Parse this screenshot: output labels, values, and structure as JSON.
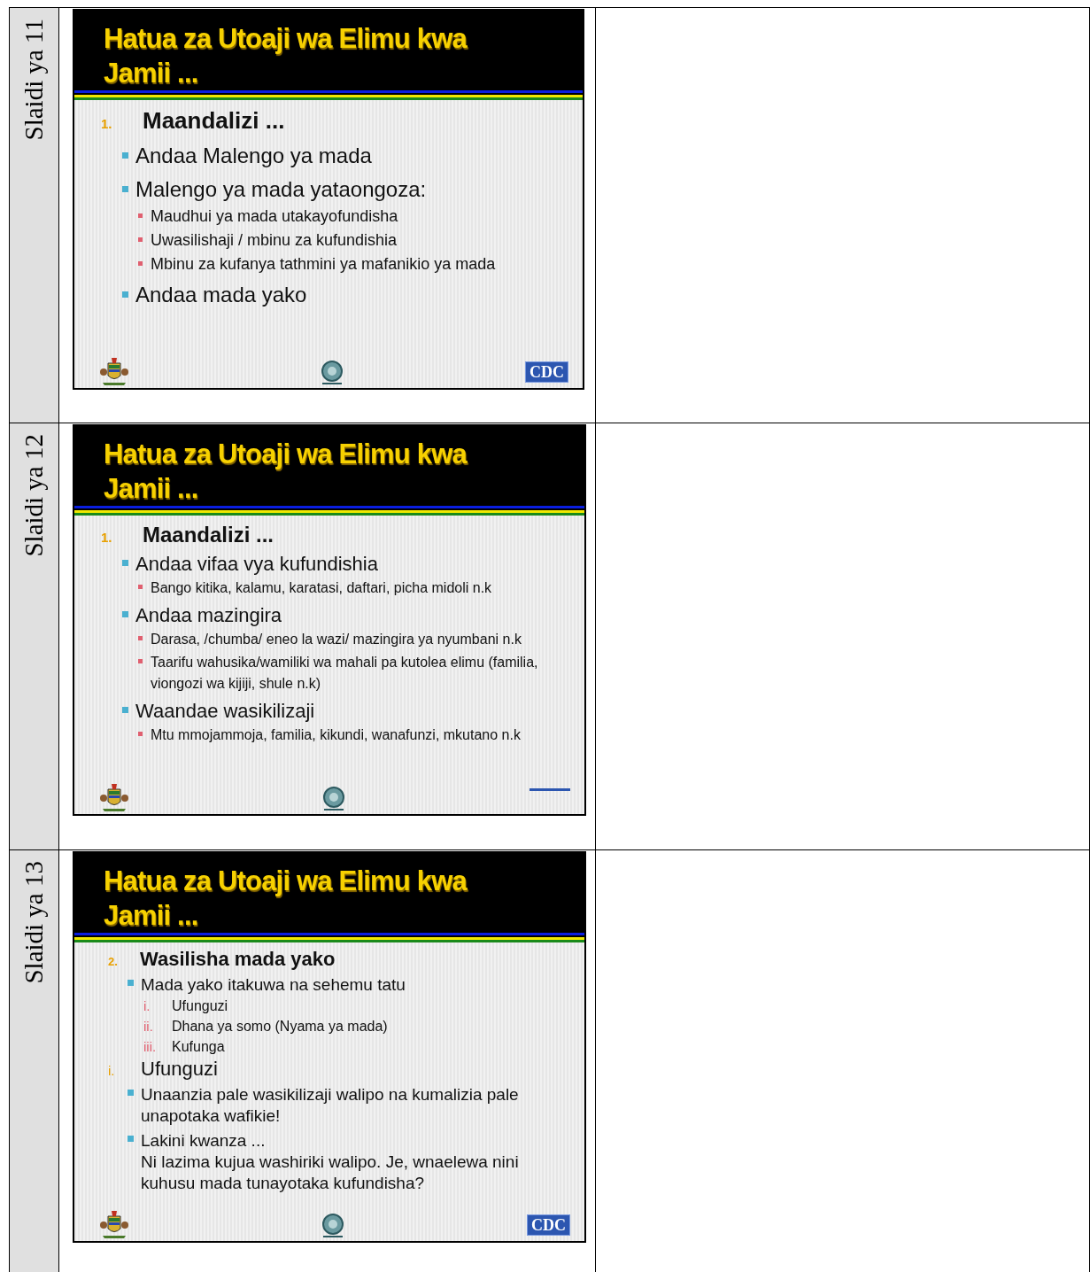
{
  "rows": [
    {
      "label": "Slaidi ya 11",
      "slide": {
        "title": "Hatua za Utoaji wa Elimu kwa Jamii ...",
        "cdc": "CDC",
        "lines": [
          {
            "kind": "heading",
            "marker": "1.",
            "text": "Maandalizi ..."
          },
          {
            "kind": "bullet",
            "text": "Andaa Malengo ya mada"
          },
          {
            "kind": "bullet",
            "text": "Malengo ya mada yataongoza:"
          },
          {
            "kind": "sub",
            "text": "Maudhui ya mada utakayofundisha"
          },
          {
            "kind": "sub",
            "text": "Uwasilishaji / mbinu za kufundishia"
          },
          {
            "kind": "sub",
            "text": "Mbinu za kufanya tathmini  ya mafanikio ya mada"
          },
          {
            "kind": "bullet",
            "text": "Andaa mada yako"
          }
        ]
      }
    },
    {
      "label": "Slaidi ya 12",
      "slide": {
        "title": "Hatua za Utoaji wa Elimu kwa Jamii ...",
        "lines": [
          {
            "kind": "heading",
            "marker": "1.",
            "text": "Maandalizi ..."
          },
          {
            "kind": "bullet",
            "text": "Andaa vifaa vya kufundishia"
          },
          {
            "kind": "sub",
            "text": "Bango kitika, kalamu, karatasi, daftari, picha midoli n.k"
          },
          {
            "kind": "bullet",
            "text": "Andaa mazingira"
          },
          {
            "kind": "sub",
            "text": "Darasa, /chumba/ eneo la wazi/ mazingira ya nyumbani n.k"
          },
          {
            "kind": "sub",
            "text": "Taarifu wahusika/wamiliki wa mahali pa kutolea elimu (familia, viongozi wa kijiji, shule n.k)"
          },
          {
            "kind": "bullet",
            "text": "Waandae wasikilizaji"
          },
          {
            "kind": "sub",
            "text": "Mtu mmojammoja, familia, kikundi, wanafunzi, mkutano n.k"
          }
        ]
      }
    },
    {
      "label": "Slaidi ya 13",
      "slide": {
        "title": "Hatua za Utoaji wa Elimu kwa Jamii ...",
        "cdc": "CDC",
        "lines": [
          {
            "kind": "heading",
            "marker": "2.",
            "text": "Wasilisha mada yako"
          },
          {
            "kind": "bullet",
            "text": "Mada yako itakuwa na sehemu tatu"
          },
          {
            "kind": "roman",
            "marker": "i.",
            "text": "Ufunguzi"
          },
          {
            "kind": "roman",
            "marker": "ii.",
            "text": "Dhana ya somo (Nyama ya mada)"
          },
          {
            "kind": "roman",
            "marker": "iii.",
            "text": "Kufunga"
          },
          {
            "kind": "section",
            "marker": "i.",
            "text": "Ufunguzi"
          },
          {
            "kind": "bullet",
            "text": "Unaanzia pale wasikilizaji walipo na kumalizia pale unapotaka wafikie!"
          },
          {
            "kind": "bullet",
            "text": "Lakini kwanza ..."
          },
          {
            "kind": "continuation",
            "text": "Ni lazima kujua washiriki walipo. Je, wnaelewa nini kuhusu mada tunayotaka kufundisha?"
          }
        ]
      }
    }
  ]
}
